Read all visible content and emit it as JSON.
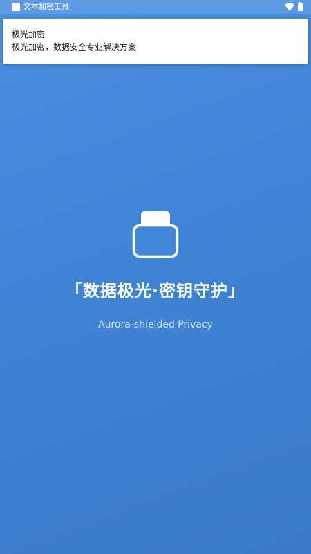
{
  "status_bar": {
    "app_name": "文本加密工具",
    "app_icon": "app-square-icon",
    "wifi_icon": "wifi-icon",
    "battery_icon": "battery-icon"
  },
  "notification": {
    "title": "极光加密",
    "body": "极光加密，数据安全专业解决方案"
  },
  "splash": {
    "icon": "lock-icon",
    "slogan": "「数据极光·密钥守护」",
    "subtitle": "Aurora-shielded Privacy"
  },
  "colors": {
    "background_top": "#4a8fe0",
    "background_bottom": "#3a7cc6",
    "text_primary": "#ffffff",
    "card": "#ffffff"
  }
}
